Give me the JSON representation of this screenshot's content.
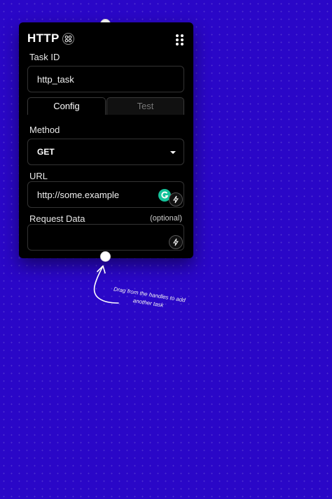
{
  "node": {
    "title": "HTTP",
    "icons": {
      "type_badge": "node-type-icon",
      "drag": "drag-dots-icon",
      "caret": "caret-down-icon",
      "variable": "lightning-icon",
      "grammar": "grammarly-icon"
    },
    "task_id": {
      "label": "Task ID",
      "value": "http_task"
    },
    "tabs": [
      {
        "label": "Config",
        "active": true
      },
      {
        "label": "Test",
        "active": false
      }
    ],
    "method": {
      "label": "Method",
      "value": "GET"
    },
    "url": {
      "label": "URL",
      "value": "http://some.example"
    },
    "request_data": {
      "label": "Request Data",
      "hint": "(optional)",
      "value": ""
    }
  },
  "hint": {
    "text_line1": "Drag from the handles to add",
    "text_line2": "another task"
  },
  "colors": {
    "canvas": "#2a07c7",
    "node_bg": "#000000",
    "border": "#333333",
    "grammarly": "#15c39a"
  }
}
